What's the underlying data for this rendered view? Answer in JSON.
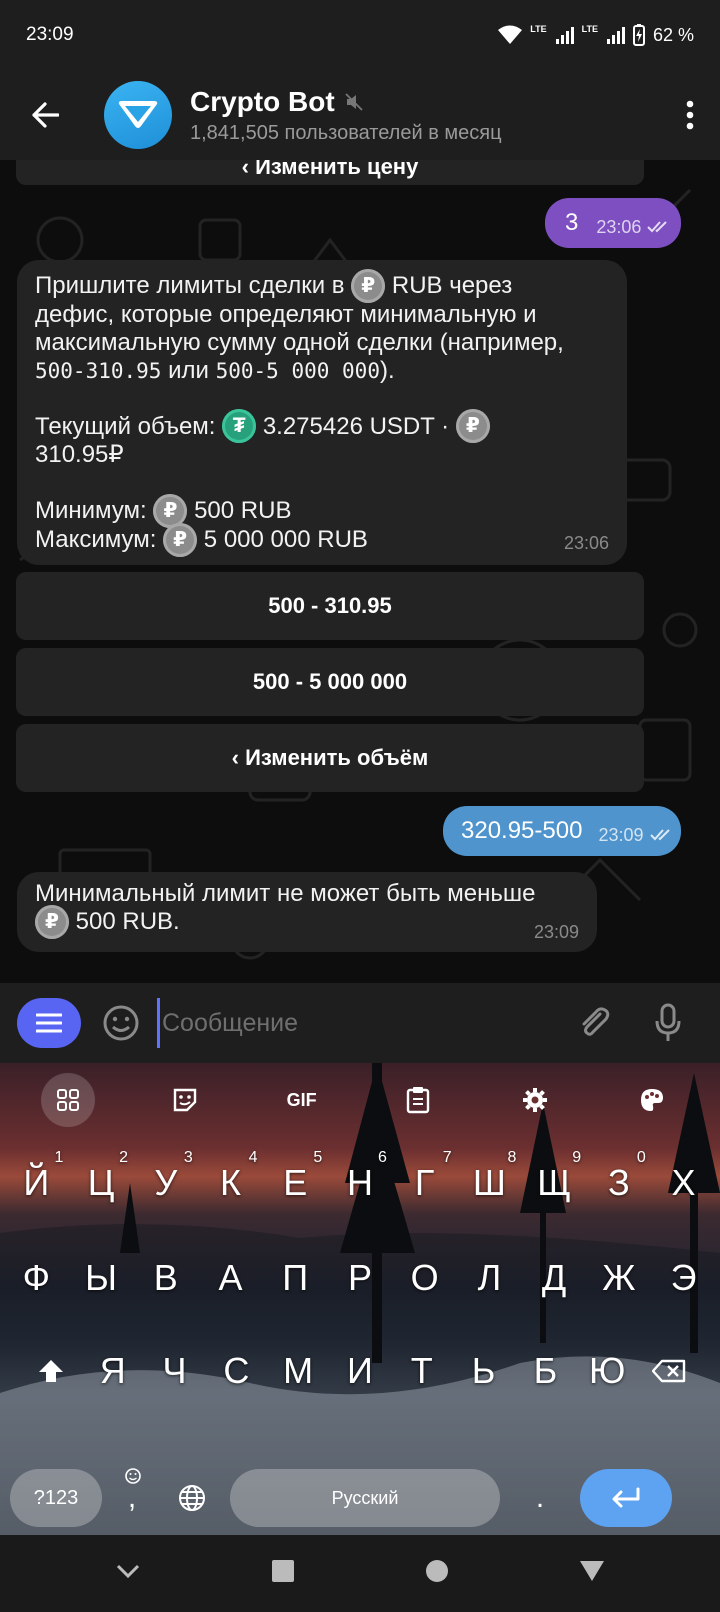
{
  "status_bar": {
    "time": "23:09",
    "lte1": "LTE",
    "lte2": "LTE",
    "battery": "62 %"
  },
  "header": {
    "title": "Crypto Bot",
    "subtitle": "1,841,505 пользователей в месяц"
  },
  "chat": {
    "partial_button": "‹ Изменить цену",
    "msg_out_1": {
      "text": "3",
      "time": "23:06"
    },
    "msg_in_1": {
      "line1a": "Пришлите лимиты сделки в",
      "line1b": "RUB через",
      "line2": "дефис, которые определяют минимальную и",
      "line3": "максимальную сумму одной сделки (например,",
      "ex1": "500-310.95",
      "or": "или",
      "ex2": "500-5 000 000",
      "ex_end": ").",
      "volume_label": "Текущий объем:",
      "volume_usdt": "3.275426 USDT ·",
      "volume_rub": "310.95₽",
      "min_label": "Минимум:",
      "min_value": "500 RUB",
      "max_label": "Максимум:",
      "max_value": "5 000 000 RUB",
      "time": "23:06"
    },
    "buttons": [
      "500 - 310.95",
      "500 - 5 000 000",
      "‹ Изменить объём"
    ],
    "msg_out_2": {
      "text": "320.95-500",
      "time": "23:09"
    },
    "msg_in_2": {
      "line1": "Минимальный лимит не может быть меньше",
      "line2": "500 RUB.",
      "time": "23:09"
    },
    "colors": {
      "out_bubble_1": "#7d4fc1",
      "out_bubble_2": "#4f94cc",
      "in_bubble": "#232323"
    }
  },
  "input": {
    "placeholder": "Сообщение"
  },
  "keyboard": {
    "toolbar": {
      "gif": "GIF"
    },
    "row1": [
      {
        "k": "Й",
        "n": "1"
      },
      {
        "k": "Ц",
        "n": "2"
      },
      {
        "k": "У",
        "n": "3"
      },
      {
        "k": "К",
        "n": "4"
      },
      {
        "k": "Е",
        "n": "5"
      },
      {
        "k": "Н",
        "n": "6"
      },
      {
        "k": "Г",
        "n": "7"
      },
      {
        "k": "Ш",
        "n": "8"
      },
      {
        "k": "Щ",
        "n": "9"
      },
      {
        "k": "З",
        "n": "0"
      },
      {
        "k": "Х",
        "n": ""
      }
    ],
    "row2": [
      "Ф",
      "Ы",
      "В",
      "А",
      "П",
      "Р",
      "О",
      "Л",
      "Д",
      "Ж",
      "Э"
    ],
    "row3": [
      "Я",
      "Ч",
      "С",
      "М",
      "И",
      "Т",
      "Ь",
      "Б",
      "Ю"
    ],
    "symbols_key": "?123",
    "comma_key": ",",
    "space_label": "Русский",
    "period_key": "."
  }
}
